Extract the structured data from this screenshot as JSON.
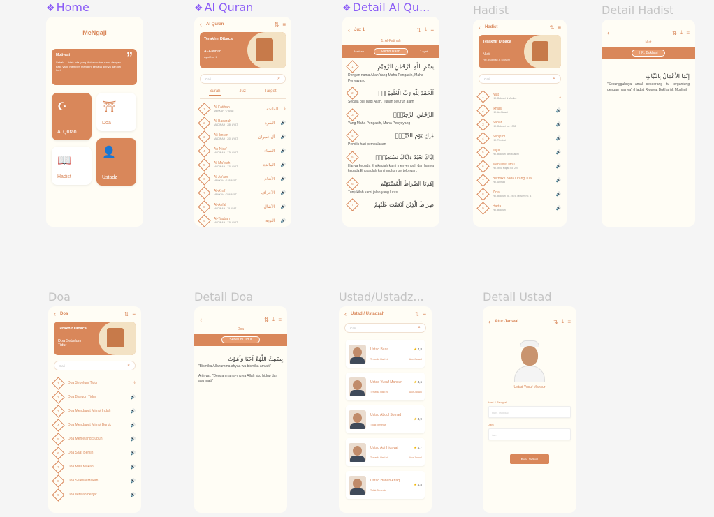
{
  "frame_labels": {
    "home": "Home",
    "alquran": "Al Quran",
    "detail_alquran": "Detail Al Qu...",
    "hadist": "Hadist",
    "detail_hadist": "Detail Hadist",
    "doa": "Doa",
    "detail_doa": "Detail Doa",
    "ustad": "Ustad/Ustadz...",
    "detail_ustad": "Detail Ustad"
  },
  "home": {
    "app_title": "MeNgaji",
    "quote_label": "Motivasi",
    "quote_text": "Sebab ... tidak ada yang dibiarkan berusaha dengan baik, yang memberi mengerti kepada dirinya dan diri hari",
    "cards": [
      "Al Quran",
      "Doa",
      "Hadist",
      "Ustadz"
    ]
  },
  "alquran": {
    "title": "Al Quran",
    "banner_title": "Terakhir Dibaca",
    "banner_surah": "Al-Fatihah",
    "banner_ayat": "Ayat No: 1",
    "search_placeholder": "Cari",
    "tabs": [
      "Surah",
      "Juz",
      "Target"
    ],
    "surahs": [
      {
        "n": "1",
        "name": "Al-Fatihah",
        "meta": "MEKKAH · 7 AYAT",
        "ar": "الفاتحة"
      },
      {
        "n": "2",
        "name": "Al-Baqarah",
        "meta": "MADINAH · 286 AYAT",
        "ar": "البقرة"
      },
      {
        "n": "3",
        "name": "Ali 'Imran",
        "meta": "MADINAH · 200 AYAT",
        "ar": "آل عمران"
      },
      {
        "n": "4",
        "name": "An-Nisa'",
        "meta": "MADINAH · 176 AYAT",
        "ar": "النساء"
      },
      {
        "n": "5",
        "name": "Al-Ma'idah",
        "meta": "MADINAH · 120 AYAT",
        "ar": "المائدة"
      },
      {
        "n": "6",
        "name": "Al-An'am",
        "meta": "MEKKAH · 165 AYAT",
        "ar": "الأنعام"
      },
      {
        "n": "7",
        "name": "Al-A'raf",
        "meta": "MEKKAH · 206 AYAT",
        "ar": "الأعراف"
      },
      {
        "n": "8",
        "name": "Al-Anfal",
        "meta": "MADINAH · 75 AYAT",
        "ar": "الأنفال"
      },
      {
        "n": "9",
        "name": "At-Taubah",
        "meta": "MADINAH · 129 AYAT",
        "ar": "التوبة"
      }
    ]
  },
  "detail_alquran": {
    "juz": "Juz 1",
    "surah_title": "1. Al-Fatihah",
    "left": "Mekkah",
    "pill": "Pembukaan",
    "right": "7 Ayat",
    "ayat": [
      {
        "n": "1",
        "ar": "بِسْمِ اللّٰهِ الرَّحْمٰنِ الرَّحِيْمِ",
        "id": "Dengan nama Allah Yang Maha Pengasih, Maha Penyayang"
      },
      {
        "n": "2",
        "ar": "اَلْحَمْدُ لِلّٰهِ رَبِّ الْعٰلَمِيْنَۙ",
        "id": "Segala puji bagi Allah, Tuhan seluruh alam"
      },
      {
        "n": "3",
        "ar": "الرَّحْمٰنِ الرَّحِيْمِۙ",
        "id": "Yang Maha Pengasih, Maha Penyayang"
      },
      {
        "n": "4",
        "ar": "مٰلِكِ يَوْمِ الدِّيْنِۗ",
        "id": "Pemilik hari pembalasan"
      },
      {
        "n": "5",
        "ar": "اِيَّاكَ نَعْبُدُ وَاِيَّاكَ نَسْتَعِيْنُۗ",
        "id": "Hanya kepada Engkaulah kami menyembah dan hanya kepada Engkaulah kami mohon pertolongan."
      },
      {
        "n": "6",
        "ar": "اِهْدِنَا الصِّرَاطَ الْمُسْتَقِيْمَ",
        "id": "Tunjukilah kami jalan yang lurus"
      },
      {
        "n": "7",
        "ar": "صِرَاطَ الَّذِيْنَ اَنْعَمْتَ عَلَيْهِمْ",
        "id": ""
      }
    ]
  },
  "hadist": {
    "title": "Hadist",
    "banner_title": "Terakhir Dibaca",
    "banner_sub": "Niat",
    "banner_src": "HR. Bukhari & Muslim",
    "search_placeholder": "Cari",
    "items": [
      {
        "n": "1",
        "t": "Niat",
        "s": "HR. Bukhari & Muslim"
      },
      {
        "n": "2",
        "t": "Ikhlas",
        "s": "HR. An-Nasa'i"
      },
      {
        "n": "3",
        "t": "Sabar",
        "s": "HR. Bukhari no. 1302"
      },
      {
        "n": "4",
        "t": "Senyum",
        "s": "HR. Tirmidzi"
      },
      {
        "n": "5",
        "t": "Jujur",
        "s": "HR. Bukhari dan Muslim"
      },
      {
        "n": "6",
        "t": "Menuntut Ilmu",
        "s": "HR. Ibnu Majah no. 224"
      },
      {
        "n": "7",
        "t": "Berbakti pada Orang Tua",
        "s": "HR. Ahmad"
      },
      {
        "n": "8",
        "t": "Zina",
        "s": "HR. Bukhari no. 2475, Muslim no. 57"
      },
      {
        "n": "9",
        "t": "Harta",
        "s": "HR. Bukhari"
      }
    ]
  },
  "detail_hadist": {
    "title": "Niat",
    "pill": "HR. Bukhari",
    "ar": "إِنَّمَا الأَعْمَالُ بِالنِّيَّاتِ",
    "text": "\"Sesungguhnya amal seseorang itu tergantung dengan niatnya\" (Hadist Riwayat Bukhari & Muslim)"
  },
  "doa": {
    "title": "Doa",
    "banner_title": "Terakhir Dibaca",
    "banner_sub": "Doa Sebelum Tidur",
    "search_placeholder": "Cari",
    "items": [
      {
        "n": "1",
        "t": "Doa Sebelum Tidur"
      },
      {
        "n": "2",
        "t": "Doa Bangun Tidur"
      },
      {
        "n": "3",
        "t": "Doa Mendapat Mimpi Indah"
      },
      {
        "n": "4",
        "t": "Doa Mendapat Mimpi Buruk"
      },
      {
        "n": "5",
        "t": "Doa Menjelang Subuh"
      },
      {
        "n": "6",
        "t": "Doa Saat Bersin"
      },
      {
        "n": "7",
        "t": "Doa Mau Makan"
      },
      {
        "n": "8",
        "t": "Doa Selesai Makan"
      },
      {
        "n": "9",
        "t": "Doa setelah bekjar"
      }
    ]
  },
  "detail_doa": {
    "title": "Doa",
    "pill": "Sebelum Tidur",
    "ar": "بِسْمِكَ اللّٰهُمَّ اَحْيَا وَاَمُوْتُ",
    "latin": "\"Bismika Allahumma ahyaa wa bismika amuut\"",
    "arti": "Artinya : \"Dengan nama-mu ya Allah aku hidup dan aku mati\""
  },
  "ustad": {
    "title": "Ustad / Ustadzah",
    "search_placeholder": "Cari",
    "items": [
      {
        "name": "Ustad Basa",
        "rating": "4,8",
        "status": "Tersedia Hari ini",
        "jadwal": "Atur Jadwal"
      },
      {
        "name": "Ustad Yusuf Mansur",
        "rating": "4,6",
        "status": "Tersedia Hari ini",
        "jadwal": "Atur Jadwal"
      },
      {
        "name": "Ustad Abdul Somad",
        "rating": "4,9",
        "status": "Tidak Tersedia",
        "jadwal": ""
      },
      {
        "name": "Ustad Adi Hidayat",
        "rating": "4,7",
        "status": "Tersedia Hari ini",
        "jadwal": "Atur Jadwal"
      },
      {
        "name": "Ustad Hanan Attaqi",
        "rating": "4,8",
        "status": "Tidak Tersedia",
        "jadwal": ""
      }
    ]
  },
  "detail_ustad": {
    "title": "Atur Jadwal",
    "name": "Ustad Yusuf Mansur",
    "date_label": "Hari & Tanggal",
    "date_placeholder": "Hari, Tanggal",
    "time_label": "Jam",
    "time_placeholder": "Jam",
    "button": "Buat Jadwal"
  },
  "icons": {
    "sort": "sort-icon",
    "download": "download-icon",
    "menu": "menu-icon",
    "back": "back-icon",
    "search": "search-icon",
    "speaker": "speaker-icon"
  },
  "colors": {
    "accent": "#d9875a",
    "bg": "#fffdf5"
  }
}
